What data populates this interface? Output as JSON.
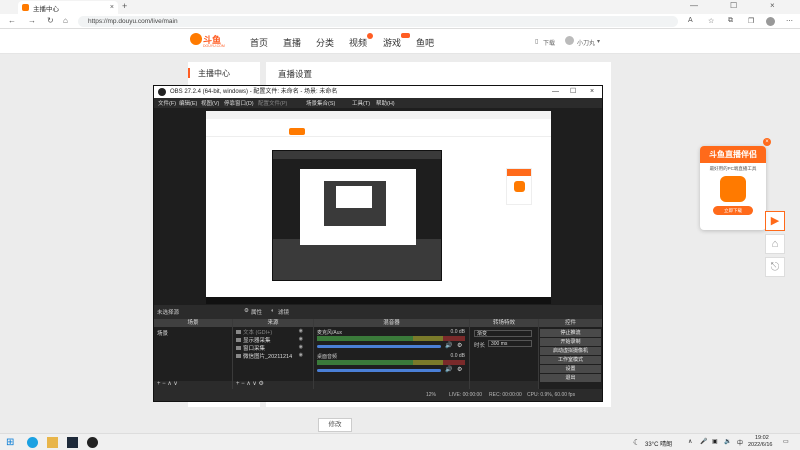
{
  "browser": {
    "tab_title": "主播中心",
    "tab_close": "×",
    "new_tab": "+",
    "url": "https://mp.douyu.com/live/main",
    "win_min": "—",
    "win_max": "☐",
    "win_close": "×"
  },
  "site": {
    "logo_text": "斗鱼",
    "logo_sub": "DOUYU.COM",
    "nav": [
      "首页",
      "直播",
      "分类",
      "视频",
      "游戏",
      "鱼吧"
    ],
    "download": "下载",
    "username": "小刀丸"
  },
  "page": {
    "sidebar_current": "主播中心",
    "main_title": "直播设置",
    "edit_button": "修改"
  },
  "promo": {
    "title": "斗鱼直播伴侣",
    "desc": "最好用的PC端直播工具",
    "download_btn": "立即下载",
    "close": "×"
  },
  "obs": {
    "title": "OBS 27.2.4 (64-bit, windows) - 配置文件: 未命名 - 场景: 未命名",
    "menu": [
      "文件(F)",
      "编辑(E)",
      "视图(V)",
      "停靠窗口(D)",
      "配置文件(P)",
      "场景集合(S)",
      "工具(T)",
      "帮助(H)"
    ],
    "no_source": "未选择源",
    "properties_btn": "属性",
    "filters_btn": "滤镜",
    "docks": {
      "scenes": "场景",
      "sources": "来源",
      "mixer": "混音器",
      "transitions": "转场特效",
      "controls": "控件"
    },
    "scene_items": [
      "场景"
    ],
    "sources": [
      "文本 (GDI+)",
      "显示器采集",
      "窗口采集",
      "微信图片_20211214"
    ],
    "mixer_channels": [
      {
        "name": "麦克风/Aux",
        "db": "0.0 dB"
      },
      {
        "name": "桌面音频",
        "db": "0.0 dB"
      }
    ],
    "transition": {
      "type": "渐变",
      "duration_label": "时长",
      "duration": "300 ms"
    },
    "controls": [
      "停止推流",
      "开始录制",
      "启动虚拟摄像机",
      "工作室模式",
      "设置",
      "退出"
    ],
    "dock_footer_controls": "+ − ∧ ∨",
    "status": {
      "live": "LIVE: 00:00:00",
      "rec": "REC: 00:00:00",
      "cpu": "CPU: 0.9%, 60.00 fps",
      "dropped": "12%"
    }
  },
  "taskbar": {
    "weather": "33°C 晴朗",
    "time": "19:02",
    "date": "2022/6/16"
  }
}
